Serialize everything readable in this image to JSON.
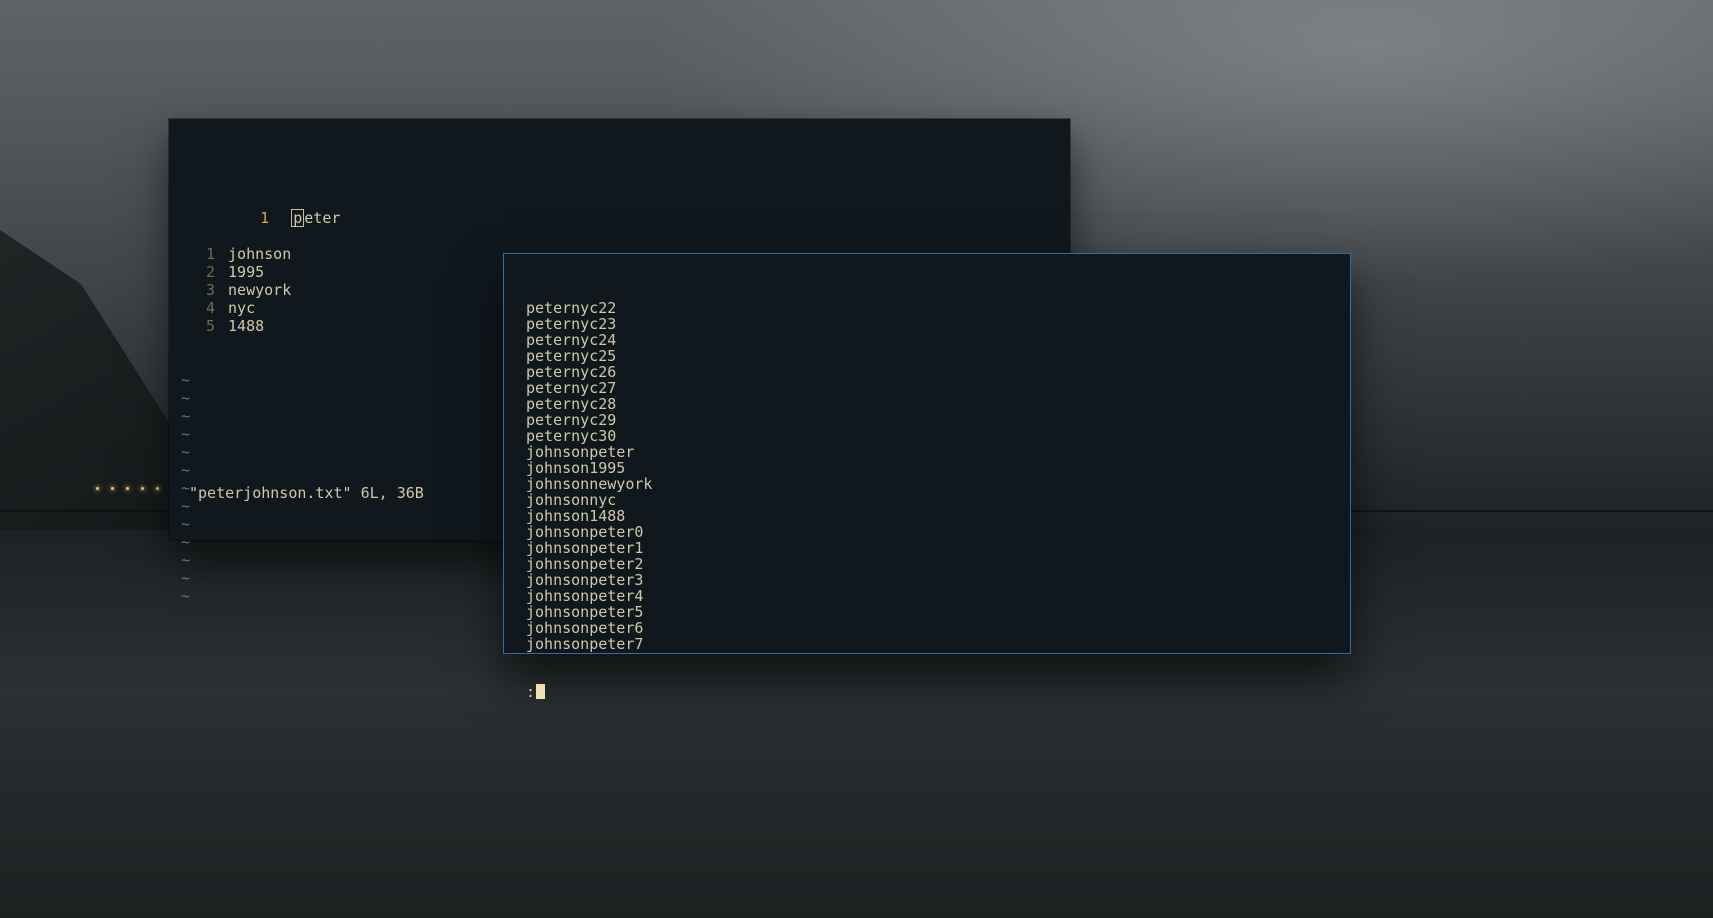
{
  "vim": {
    "current_line_number": "1",
    "current_line_text": "eter",
    "cursor_char": "p",
    "relative_lines": [
      {
        "n": "1",
        "text": "johnson"
      },
      {
        "n": "2",
        "text": "1995"
      },
      {
        "n": "3",
        "text": "newyork"
      },
      {
        "n": "4",
        "text": "nyc"
      },
      {
        "n": "5",
        "text": "1488"
      }
    ],
    "tilde": "~",
    "tilde_count": 13,
    "status": "\"peterjohnson.txt\" 6L, 36B"
  },
  "output": {
    "lines": [
      "peternyc22",
      "peternyc23",
      "peternyc24",
      "peternyc25",
      "peternyc26",
      "peternyc27",
      "peternyc28",
      "peternyc29",
      "peternyc30",
      "johnsonpeter",
      "johnson1995",
      "johnsonnewyork",
      "johnsonnyc",
      "johnson1488",
      "johnsonpeter0",
      "johnsonpeter1",
      "johnsonpeter2",
      "johnsonpeter3",
      "johnsonpeter4",
      "johnsonpeter5",
      "johnsonpeter6",
      "johnsonpeter7"
    ],
    "prompt": ":"
  }
}
